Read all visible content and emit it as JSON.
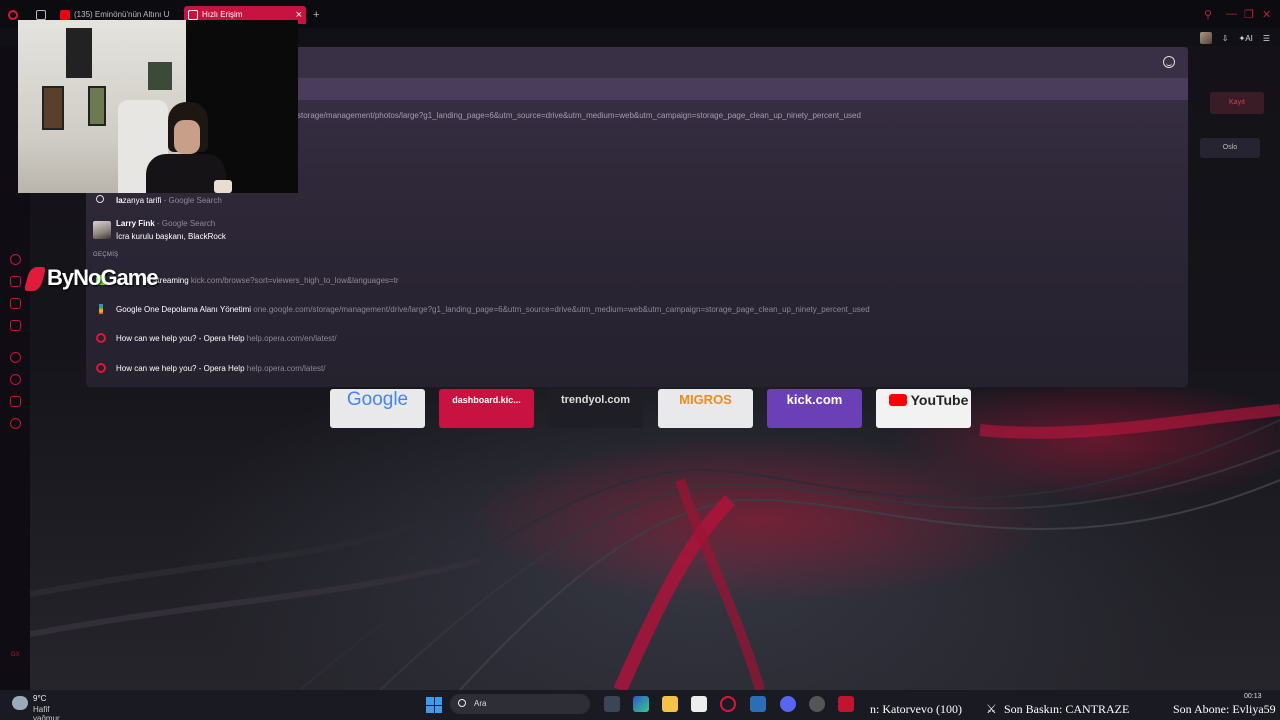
{
  "tabs": [
    {
      "label": "(135) Eminönü'nün Altını U",
      "active": false
    },
    {
      "label": "Hızlı Erişim",
      "active": true
    }
  ],
  "tab_close": "×",
  "new_tab": "+",
  "toolbar": {
    "ai_label": "AI"
  },
  "omnibox": {
    "highlighted_url": "storage/management/photos/large?g1_landing_page=6&utm_source=drive&utm_medium=web&utm_campaign=storage_page_clean_up_ninety_percent_used"
  },
  "suggestions": [
    {
      "title_bold": "la",
      "title": "zanya tarifi",
      "source": "- Google Search"
    },
    {
      "title_bold": "Larry Fink",
      "source": "- Google Search",
      "subtitle": "İcra kurulu başkanı, BlackRock"
    }
  ],
  "history_label": "GEÇMİŞ",
  "history": [
    {
      "title": "k Streaming",
      "url": "kick.com/browse?sort=viewers_high_to_low&languages=tr"
    },
    {
      "title": "Google One Depolama Alanı Yönetimi",
      "url": "one.google.com/storage/management/drive/large?g1_landing_page=6&utm_source=drive&utm_medium=web&utm_campaign=storage_page_clean_up_ninety_percent_used"
    },
    {
      "title": "How can we help you? - Opera Help",
      "url": "help.opera.com/en/latest/"
    },
    {
      "title": "How can we help you? - Opera Help",
      "url": "help.opera.com/latest/"
    }
  ],
  "speed_dial": [
    {
      "label": "Google",
      "color": "#e9e9ec"
    },
    {
      "label": "dashboard.kic...",
      "color": "#c8123f"
    },
    {
      "label": "trendyol.com",
      "color": "#222228"
    },
    {
      "label": "MIGROS",
      "color": "#e9e9ec"
    },
    {
      "label": "kick.com",
      "color": "#6b3fb6"
    },
    {
      "label": "YouTube",
      "color": "#f2f2f2"
    }
  ],
  "right_widgets": [
    "Kayıt",
    "Oslo"
  ],
  "brand": "ByNoGame",
  "taskbar": {
    "temp": "9°C",
    "weather": "Hafif yağmur",
    "search": "Ara",
    "ticker": [
      "n: Katorvevo (100)",
      "Son Baskın: CANTRAZE",
      "Son Abone: Evliya59"
    ],
    "time": "00:13"
  },
  "sidebar_label": "GX",
  "colors": {
    "accent": "#c8123f",
    "overlay": "#2e2838"
  }
}
